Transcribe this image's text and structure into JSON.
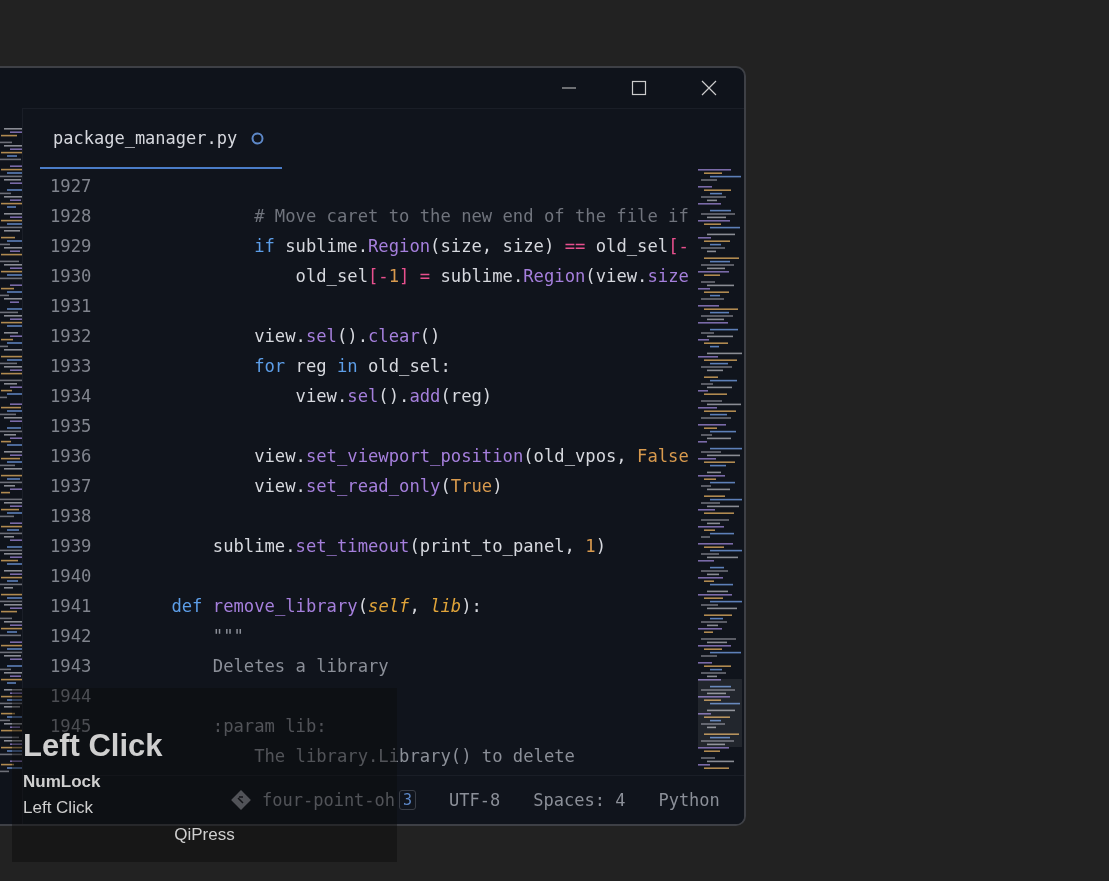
{
  "window": {
    "controls": [
      {
        "kind": "minimize"
      },
      {
        "kind": "maximize"
      },
      {
        "kind": "close"
      }
    ]
  },
  "tabs": [
    {
      "label": "package_manager.py",
      "selected": true,
      "modified": true
    }
  ],
  "editor": {
    "lines": [
      {
        "number": "1927"
      },
      {
        "number": "1928",
        "tokens": [
          {
            "text": "            # Move caret to the new end of the file if",
            "kind": "comment"
          }
        ]
      },
      {
        "number": "1929",
        "tokens": [
          {
            "text": "            if",
            "kind": "keyword"
          },
          {
            "text": " sublime.",
            "kind": "plain"
          },
          {
            "text": "Region",
            "kind": "func"
          },
          {
            "text": "(size, size) ",
            "kind": "plain"
          },
          {
            "text": "==",
            "kind": "operator"
          },
          {
            "text": " old_sel",
            "kind": "plain"
          },
          {
            "text": "[-",
            "kind": "operator"
          }
        ]
      },
      {
        "number": "1930",
        "tokens": [
          {
            "text": "                old_sel",
            "kind": "plain"
          },
          {
            "text": "[-",
            "kind": "operator"
          },
          {
            "text": "1",
            "kind": "number"
          },
          {
            "text": "]",
            "kind": "operator"
          },
          {
            "text": " =",
            "kind": "operator"
          },
          {
            "text": " sublime.",
            "kind": "plain"
          },
          {
            "text": "Region",
            "kind": "func"
          },
          {
            "text": "(view.",
            "kind": "plain"
          },
          {
            "text": "size",
            "kind": "func"
          }
        ]
      },
      {
        "number": "1931"
      },
      {
        "number": "1932",
        "tokens": [
          {
            "text": "            view.",
            "kind": "plain"
          },
          {
            "text": "sel",
            "kind": "func"
          },
          {
            "text": "().",
            "kind": "plain"
          },
          {
            "text": "clear",
            "kind": "func"
          },
          {
            "text": "()",
            "kind": "plain"
          }
        ]
      },
      {
        "number": "1933",
        "tokens": [
          {
            "text": "            for",
            "kind": "keyword"
          },
          {
            "text": " reg ",
            "kind": "plain"
          },
          {
            "text": "in",
            "kind": "keyword"
          },
          {
            "text": " old_sel:",
            "kind": "plain"
          }
        ]
      },
      {
        "number": "1934",
        "tokens": [
          {
            "text": "                view.",
            "kind": "plain"
          },
          {
            "text": "sel",
            "kind": "func"
          },
          {
            "text": "().",
            "kind": "plain"
          },
          {
            "text": "add",
            "kind": "func"
          },
          {
            "text": "(reg)",
            "kind": "plain"
          }
        ]
      },
      {
        "number": "1935"
      },
      {
        "number": "1936",
        "tokens": [
          {
            "text": "            view.",
            "kind": "plain"
          },
          {
            "text": "set_viewport_position",
            "kind": "func"
          },
          {
            "text": "(old_vpos, ",
            "kind": "plain"
          },
          {
            "text": "False",
            "kind": "number"
          }
        ]
      },
      {
        "number": "1937",
        "tokens": [
          {
            "text": "            view.",
            "kind": "plain"
          },
          {
            "text": "set_read_only",
            "kind": "func"
          },
          {
            "text": "(",
            "kind": "plain"
          },
          {
            "text": "True",
            "kind": "number"
          },
          {
            "text": ")",
            "kind": "plain"
          }
        ]
      },
      {
        "number": "1938"
      },
      {
        "number": "1939",
        "tokens": [
          {
            "text": "        sublime.",
            "kind": "plain"
          },
          {
            "text": "set_timeout",
            "kind": "func"
          },
          {
            "text": "(print_to_panel, ",
            "kind": "plain"
          },
          {
            "text": "1",
            "kind": "number"
          },
          {
            "text": ")",
            "kind": "plain"
          }
        ]
      },
      {
        "number": "1940"
      },
      {
        "number": "1941",
        "tokens": [
          {
            "text": "    def ",
            "kind": "keyword"
          },
          {
            "text": "remove_library",
            "kind": "func"
          },
          {
            "text": "(",
            "kind": "plain"
          },
          {
            "text": "self",
            "kind": "param"
          },
          {
            "text": ", ",
            "kind": "plain"
          },
          {
            "text": "lib",
            "kind": "param"
          },
          {
            "text": "):",
            "kind": "plain"
          }
        ]
      },
      {
        "number": "1942",
        "tokens": [
          {
            "text": "        \"\"\"",
            "kind": "string"
          }
        ]
      },
      {
        "number": "1943",
        "tokens": [
          {
            "text": "        Deletes a library",
            "kind": "string"
          }
        ]
      },
      {
        "number": "1944"
      },
      {
        "number": "1945",
        "tokens": [
          {
            "text": "        :param lib:",
            "kind": "string"
          }
        ]
      },
      {
        "tokens": [
          {
            "text": "            The library.Library() to delete",
            "kind": "string"
          }
        ]
      }
    ]
  },
  "status_bar": {
    "branch": "four-point-oh",
    "badge": "3",
    "encoding": "UTF-8",
    "indentation": "Spaces: 4",
    "syntax": "Python"
  },
  "key_overlay": {
    "title": "Left Click",
    "modifier": "NumLock",
    "action": "Left Click",
    "app_name": "QiPress"
  }
}
